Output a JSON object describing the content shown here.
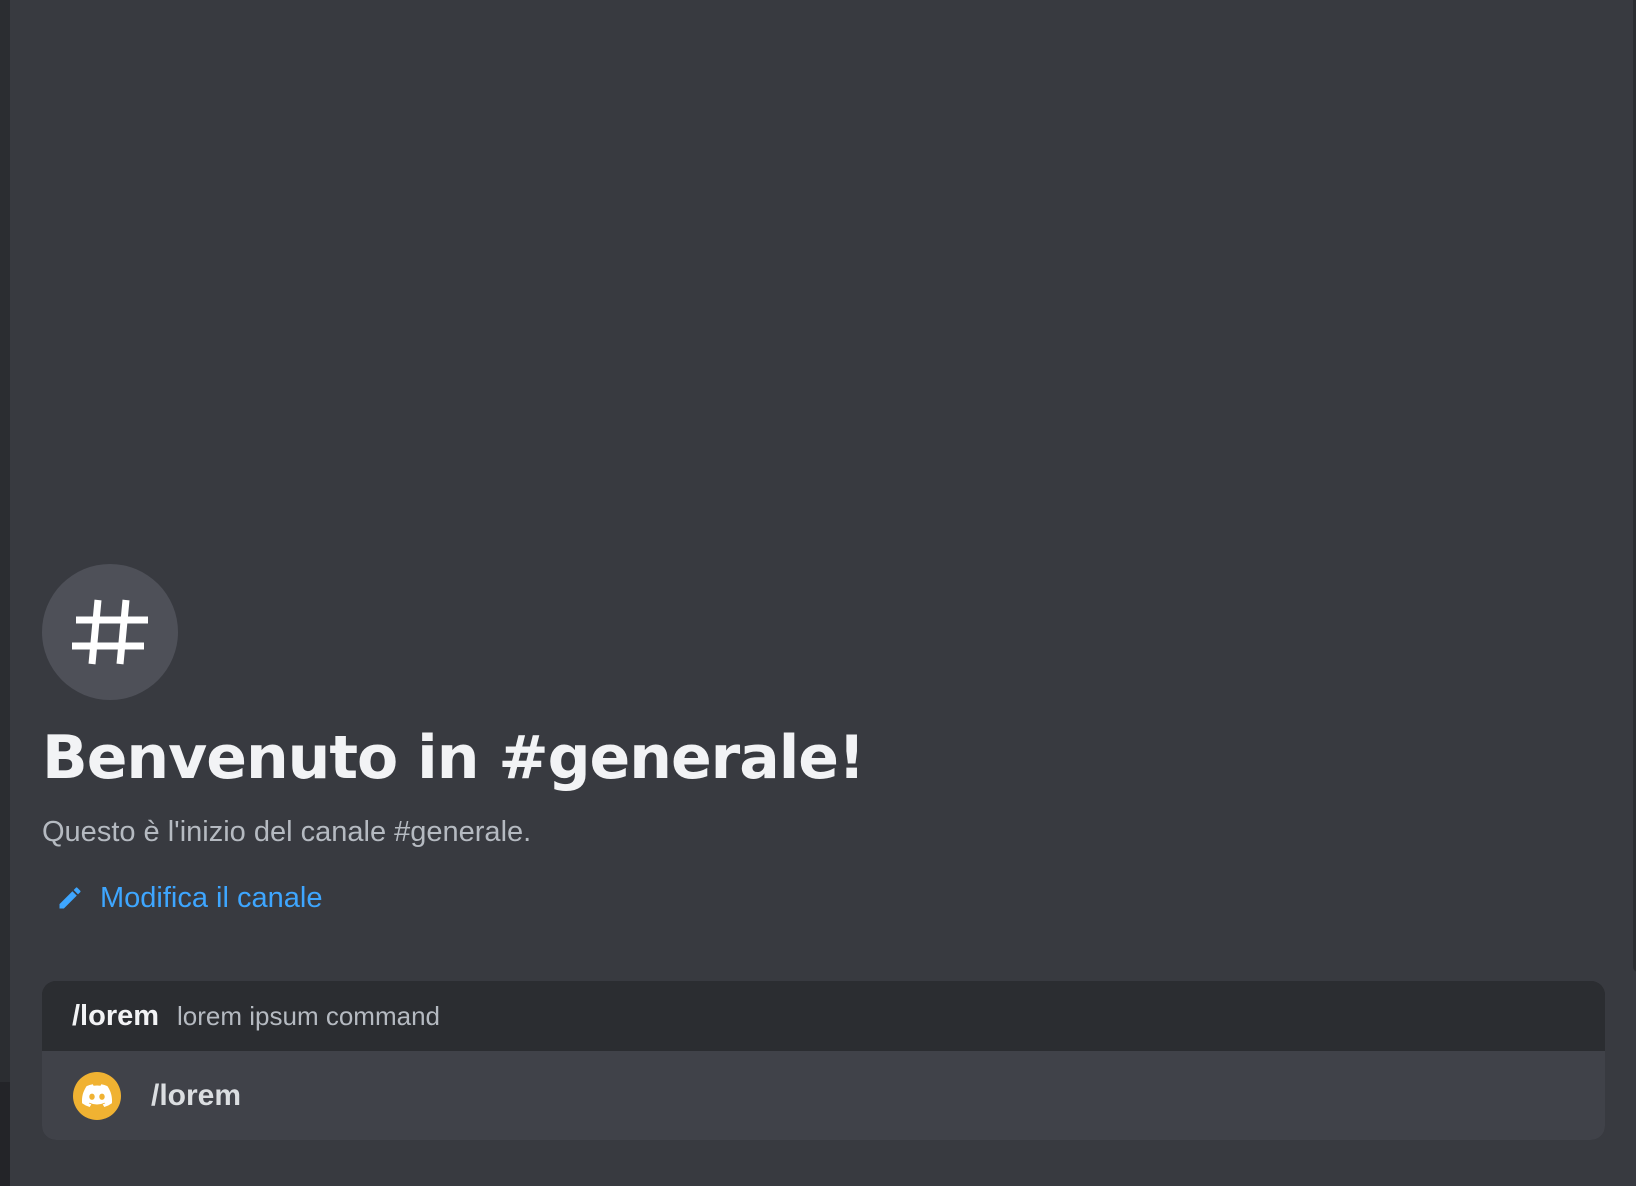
{
  "colors": {
    "background": "#383a40",
    "sidebar": "#2b2d31",
    "link": "#3ea6ff",
    "app_icon_bg": "#f0b232",
    "channel_icon_bg": "#4e5058"
  },
  "welcome": {
    "icon": "hashtag-icon",
    "title": "Benvenuto in #generale!",
    "subtitle": "Questo è l'inizio del canale #generale.",
    "edit_link": {
      "icon": "pencil-icon",
      "label": "Modifica il canale"
    }
  },
  "autocomplete": {
    "header": {
      "command": "/lorem",
      "description": "lorem ipsum command"
    },
    "items": [
      {
        "icon": "discord-logo-icon",
        "label": "/lorem"
      }
    ]
  }
}
